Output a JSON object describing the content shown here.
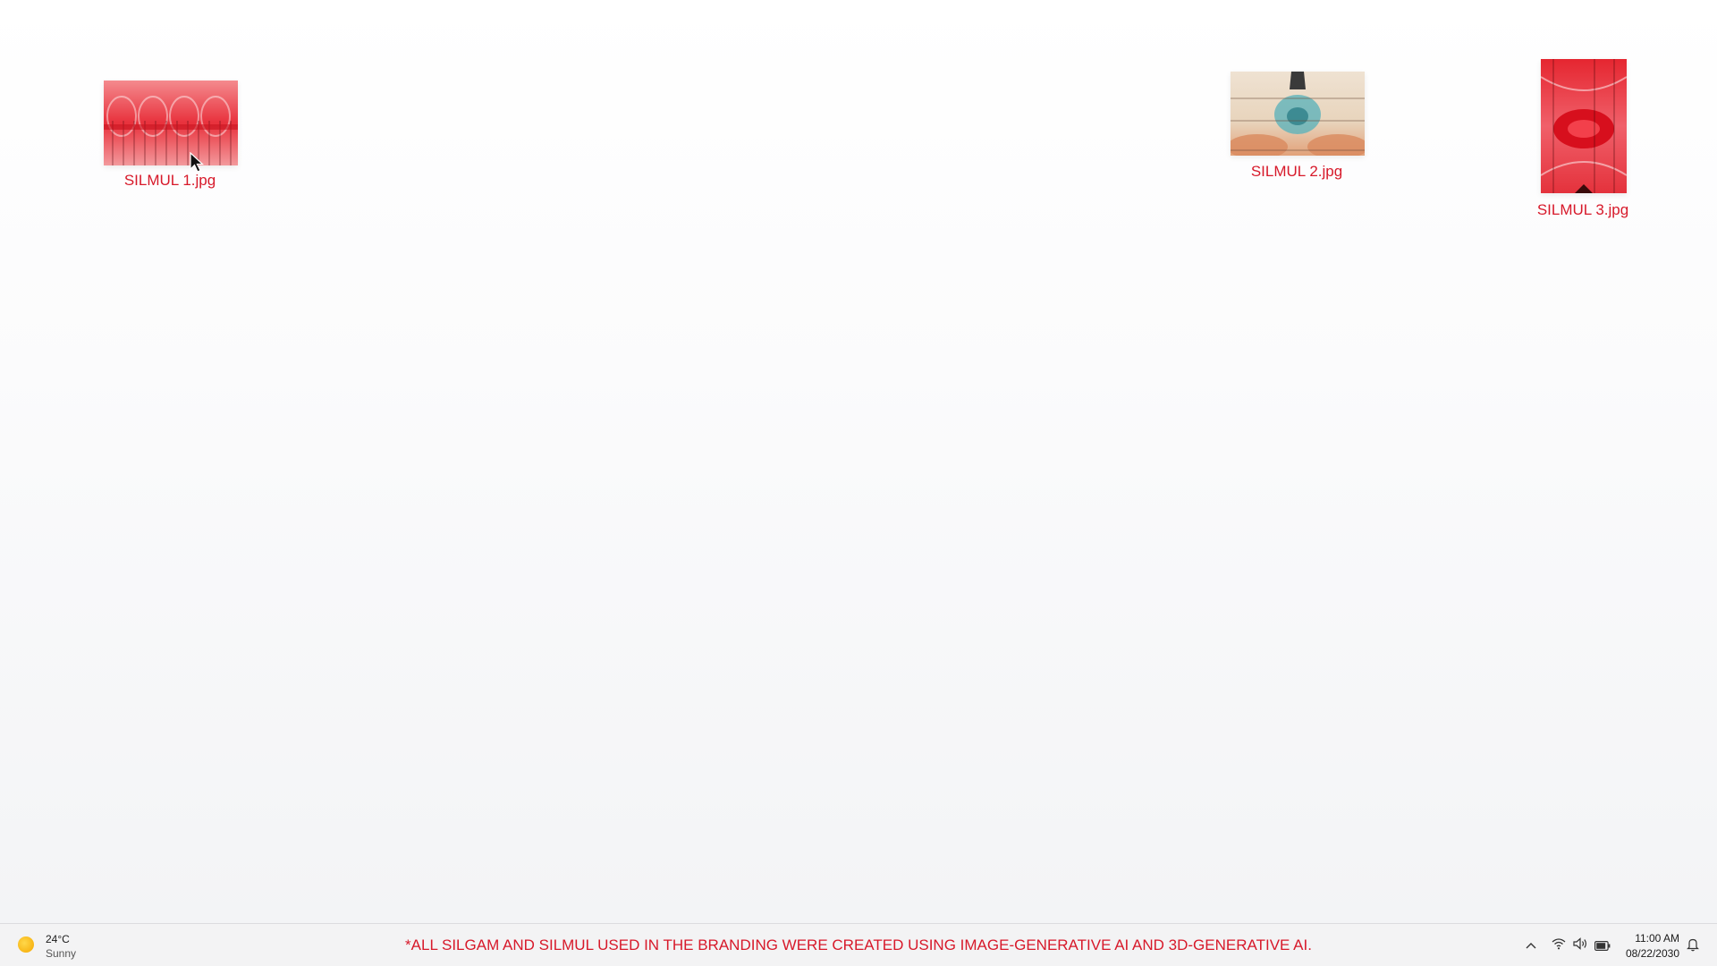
{
  "desktop": {
    "files": [
      {
        "name": "SILMUL 1.jpg",
        "thumbnail_icon": "red-abstract-thumbnail-icon"
      },
      {
        "name": "SILMUL 2.jpg",
        "thumbnail_icon": "beige-teal-abstract-thumbnail-icon"
      },
      {
        "name": "SILMUL 3.jpg",
        "thumbnail_icon": "red-portrait-abstract-thumbnail-icon"
      }
    ]
  },
  "taskbar": {
    "weather": {
      "temperature": "24°C",
      "condition": "Sunny",
      "icon": "sun-icon"
    },
    "disclaimer": "*ALL SILGAM AND SILMUL USED IN THE BRANDING WERE CREATED USING IMAGE-GENERATIVE AI AND 3D-GENERATIVE AI.",
    "tray_icons": [
      "chevron-up-icon",
      "wifi-icon",
      "speaker-icon",
      "battery-icon"
    ],
    "clock": {
      "time": "11:00 AM",
      "date": "08/22/2030"
    },
    "notification_icon": "bell-icon"
  },
  "colors": {
    "accent_red": "#d7192a",
    "taskbar_bg": "#f3f3f4"
  }
}
